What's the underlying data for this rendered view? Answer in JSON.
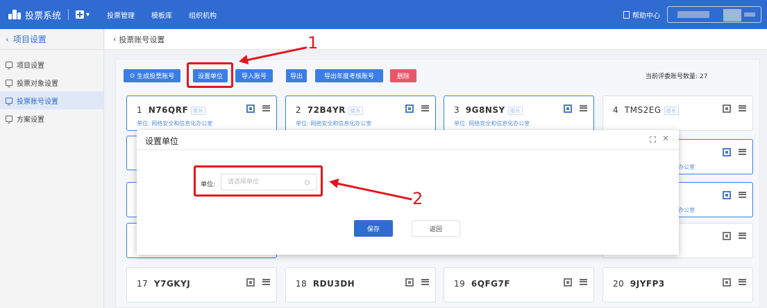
{
  "app": {
    "title": "投票系统"
  },
  "nav": [
    "投票管理",
    "模板库",
    "组织机构"
  ],
  "help": "帮助中心",
  "sidebar": {
    "back_label": "项目设置",
    "items": [
      "项目设置",
      "投票对象设置",
      "投票账号设置",
      "方案设置"
    ]
  },
  "page": {
    "breadcrumb": "投票账号设置"
  },
  "toolbar": {
    "generate": "生成投票账号",
    "set_unit": "设置单位",
    "import": "导入账号",
    "export": "导出",
    "export_annual": "导出年度考核账号",
    "delete": "删除",
    "count_label": "当前评委账号数量: 27"
  },
  "cards": [
    {
      "num": "1",
      "code": "N76QRF",
      "tag": "组长",
      "unit": "单位: 网络安全和信息化办公室"
    },
    {
      "num": "2",
      "code": "72B4YR",
      "tag": "组长",
      "unit": "单位: 网络安全和信息化办公室"
    },
    {
      "num": "3",
      "code": "9G8NSY",
      "tag": "组长",
      "unit": "单位: 网络安全和信息化办公室"
    },
    {
      "num": "4",
      "code": "TMS2EG",
      "tag": "组长",
      "unit": ""
    },
    {
      "num": "17",
      "code": "Y7GKYJ"
    },
    {
      "num": "18",
      "code": "RDU3DH"
    },
    {
      "num": "19",
      "code": "6QFG7F"
    },
    {
      "num": "20",
      "code": "9JYFP3"
    }
  ],
  "partial_unit": "办公室",
  "dialog": {
    "title": "设置单位",
    "field_label": "单位:",
    "placeholder": "请选择单位",
    "save": "保存",
    "back": "返回"
  },
  "annotations": [
    "1",
    "2"
  ],
  "colors": {
    "primary": "#2f6bd1",
    "danger": "#e8576a",
    "annotation": "#e0171f"
  }
}
